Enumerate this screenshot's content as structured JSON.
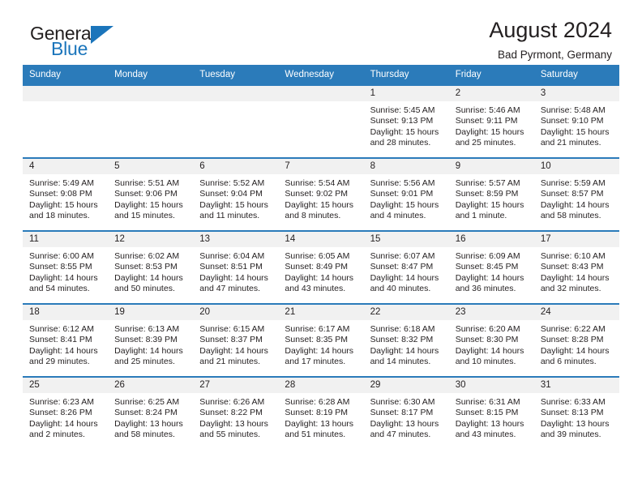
{
  "brand": {
    "name_part1": "General",
    "name_part2": "Blue",
    "accent_color": "#1b75bb"
  },
  "header": {
    "title": "August 2024",
    "subtitle": "Bad Pyrmont, Germany"
  },
  "theme": {
    "header_row_bg": "#2b7bba",
    "daynum_bg": "#f1f1f1",
    "text_color": "#231f20"
  },
  "weekdays": [
    "Sunday",
    "Monday",
    "Tuesday",
    "Wednesday",
    "Thursday",
    "Friday",
    "Saturday"
  ],
  "labels": {
    "sunrise_prefix": "Sunrise:",
    "sunset_prefix": "Sunset:",
    "daylight_prefix": "Daylight:"
  },
  "weeks": [
    [
      {
        "empty": true
      },
      {
        "empty": true
      },
      {
        "empty": true
      },
      {
        "empty": true
      },
      {
        "day": "1",
        "sunrise": "Sunrise: 5:45 AM",
        "sunset": "Sunset: 9:13 PM",
        "daylight_line1": "Daylight: 15 hours",
        "daylight_line2": "and 28 minutes."
      },
      {
        "day": "2",
        "sunrise": "Sunrise: 5:46 AM",
        "sunset": "Sunset: 9:11 PM",
        "daylight_line1": "Daylight: 15 hours",
        "daylight_line2": "and 25 minutes."
      },
      {
        "day": "3",
        "sunrise": "Sunrise: 5:48 AM",
        "sunset": "Sunset: 9:10 PM",
        "daylight_line1": "Daylight: 15 hours",
        "daylight_line2": "and 21 minutes."
      }
    ],
    [
      {
        "day": "4",
        "sunrise": "Sunrise: 5:49 AM",
        "sunset": "Sunset: 9:08 PM",
        "daylight_line1": "Daylight: 15 hours",
        "daylight_line2": "and 18 minutes."
      },
      {
        "day": "5",
        "sunrise": "Sunrise: 5:51 AM",
        "sunset": "Sunset: 9:06 PM",
        "daylight_line1": "Daylight: 15 hours",
        "daylight_line2": "and 15 minutes."
      },
      {
        "day": "6",
        "sunrise": "Sunrise: 5:52 AM",
        "sunset": "Sunset: 9:04 PM",
        "daylight_line1": "Daylight: 15 hours",
        "daylight_line2": "and 11 minutes."
      },
      {
        "day": "7",
        "sunrise": "Sunrise: 5:54 AM",
        "sunset": "Sunset: 9:02 PM",
        "daylight_line1": "Daylight: 15 hours",
        "daylight_line2": "and 8 minutes."
      },
      {
        "day": "8",
        "sunrise": "Sunrise: 5:56 AM",
        "sunset": "Sunset: 9:01 PM",
        "daylight_line1": "Daylight: 15 hours",
        "daylight_line2": "and 4 minutes."
      },
      {
        "day": "9",
        "sunrise": "Sunrise: 5:57 AM",
        "sunset": "Sunset: 8:59 PM",
        "daylight_line1": "Daylight: 15 hours",
        "daylight_line2": "and 1 minute."
      },
      {
        "day": "10",
        "sunrise": "Sunrise: 5:59 AM",
        "sunset": "Sunset: 8:57 PM",
        "daylight_line1": "Daylight: 14 hours",
        "daylight_line2": "and 58 minutes."
      }
    ],
    [
      {
        "day": "11",
        "sunrise": "Sunrise: 6:00 AM",
        "sunset": "Sunset: 8:55 PM",
        "daylight_line1": "Daylight: 14 hours",
        "daylight_line2": "and 54 minutes."
      },
      {
        "day": "12",
        "sunrise": "Sunrise: 6:02 AM",
        "sunset": "Sunset: 8:53 PM",
        "daylight_line1": "Daylight: 14 hours",
        "daylight_line2": "and 50 minutes."
      },
      {
        "day": "13",
        "sunrise": "Sunrise: 6:04 AM",
        "sunset": "Sunset: 8:51 PM",
        "daylight_line1": "Daylight: 14 hours",
        "daylight_line2": "and 47 minutes."
      },
      {
        "day": "14",
        "sunrise": "Sunrise: 6:05 AM",
        "sunset": "Sunset: 8:49 PM",
        "daylight_line1": "Daylight: 14 hours",
        "daylight_line2": "and 43 minutes."
      },
      {
        "day": "15",
        "sunrise": "Sunrise: 6:07 AM",
        "sunset": "Sunset: 8:47 PM",
        "daylight_line1": "Daylight: 14 hours",
        "daylight_line2": "and 40 minutes."
      },
      {
        "day": "16",
        "sunrise": "Sunrise: 6:09 AM",
        "sunset": "Sunset: 8:45 PM",
        "daylight_line1": "Daylight: 14 hours",
        "daylight_line2": "and 36 minutes."
      },
      {
        "day": "17",
        "sunrise": "Sunrise: 6:10 AM",
        "sunset": "Sunset: 8:43 PM",
        "daylight_line1": "Daylight: 14 hours",
        "daylight_line2": "and 32 minutes."
      }
    ],
    [
      {
        "day": "18",
        "sunrise": "Sunrise: 6:12 AM",
        "sunset": "Sunset: 8:41 PM",
        "daylight_line1": "Daylight: 14 hours",
        "daylight_line2": "and 29 minutes."
      },
      {
        "day": "19",
        "sunrise": "Sunrise: 6:13 AM",
        "sunset": "Sunset: 8:39 PM",
        "daylight_line1": "Daylight: 14 hours",
        "daylight_line2": "and 25 minutes."
      },
      {
        "day": "20",
        "sunrise": "Sunrise: 6:15 AM",
        "sunset": "Sunset: 8:37 PM",
        "daylight_line1": "Daylight: 14 hours",
        "daylight_line2": "and 21 minutes."
      },
      {
        "day": "21",
        "sunrise": "Sunrise: 6:17 AM",
        "sunset": "Sunset: 8:35 PM",
        "daylight_line1": "Daylight: 14 hours",
        "daylight_line2": "and 17 minutes."
      },
      {
        "day": "22",
        "sunrise": "Sunrise: 6:18 AM",
        "sunset": "Sunset: 8:32 PM",
        "daylight_line1": "Daylight: 14 hours",
        "daylight_line2": "and 14 minutes."
      },
      {
        "day": "23",
        "sunrise": "Sunrise: 6:20 AM",
        "sunset": "Sunset: 8:30 PM",
        "daylight_line1": "Daylight: 14 hours",
        "daylight_line2": "and 10 minutes."
      },
      {
        "day": "24",
        "sunrise": "Sunrise: 6:22 AM",
        "sunset": "Sunset: 8:28 PM",
        "daylight_line1": "Daylight: 14 hours",
        "daylight_line2": "and 6 minutes."
      }
    ],
    [
      {
        "day": "25",
        "sunrise": "Sunrise: 6:23 AM",
        "sunset": "Sunset: 8:26 PM",
        "daylight_line1": "Daylight: 14 hours",
        "daylight_line2": "and 2 minutes."
      },
      {
        "day": "26",
        "sunrise": "Sunrise: 6:25 AM",
        "sunset": "Sunset: 8:24 PM",
        "daylight_line1": "Daylight: 13 hours",
        "daylight_line2": "and 58 minutes."
      },
      {
        "day": "27",
        "sunrise": "Sunrise: 6:26 AM",
        "sunset": "Sunset: 8:22 PM",
        "daylight_line1": "Daylight: 13 hours",
        "daylight_line2": "and 55 minutes."
      },
      {
        "day": "28",
        "sunrise": "Sunrise: 6:28 AM",
        "sunset": "Sunset: 8:19 PM",
        "daylight_line1": "Daylight: 13 hours",
        "daylight_line2": "and 51 minutes."
      },
      {
        "day": "29",
        "sunrise": "Sunrise: 6:30 AM",
        "sunset": "Sunset: 8:17 PM",
        "daylight_line1": "Daylight: 13 hours",
        "daylight_line2": "and 47 minutes."
      },
      {
        "day": "30",
        "sunrise": "Sunrise: 6:31 AM",
        "sunset": "Sunset: 8:15 PM",
        "daylight_line1": "Daylight: 13 hours",
        "daylight_line2": "and 43 minutes."
      },
      {
        "day": "31",
        "sunrise": "Sunrise: 6:33 AM",
        "sunset": "Sunset: 8:13 PM",
        "daylight_line1": "Daylight: 13 hours",
        "daylight_line2": "and 39 minutes."
      }
    ]
  ]
}
